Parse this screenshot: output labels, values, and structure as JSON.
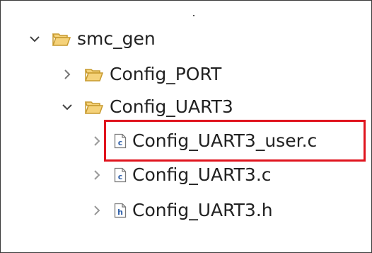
{
  "tree": {
    "items": [
      {
        "label": "smc_gen",
        "state": "expanded",
        "icon": "folder-open-icon"
      },
      {
        "label": "Config_PORT",
        "state": "collapsed",
        "icon": "folder-open-icon"
      },
      {
        "label": "Config_UART3",
        "state": "expanded",
        "icon": "folder-open-icon"
      },
      {
        "label": "Config_UART3_user.c",
        "state": "collapsed",
        "icon": "c-file-icon",
        "highlighted": true
      },
      {
        "label": "Config_UART3.c",
        "state": "collapsed",
        "icon": "c-file-icon"
      },
      {
        "label": "Config_UART3.h",
        "state": "collapsed",
        "icon": "h-file-icon"
      }
    ]
  },
  "colors": {
    "highlight_border": "#e0141e",
    "folder_fill": "#f5d27a",
    "folder_stroke": "#c79a2e",
    "file_glyph": "#2f5fa8"
  },
  "icons": {
    "c_glyph": "c",
    "h_glyph": "h"
  }
}
